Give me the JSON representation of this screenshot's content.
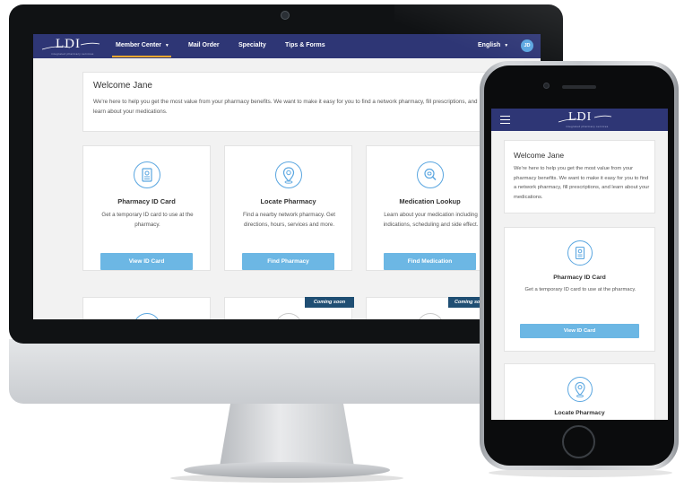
{
  "brand": {
    "logo_text": "LDI",
    "tagline": "integrated pharmacy services"
  },
  "desktop": {
    "nav": {
      "items": [
        {
          "label": "Member Center",
          "dropdown": true,
          "active": true
        },
        {
          "label": "Mail Order"
        },
        {
          "label": "Specialty"
        },
        {
          "label": "Tips & Forms"
        }
      ],
      "language": "English",
      "avatar_initials": "JD"
    },
    "welcome": {
      "title": "Welcome Jane",
      "text": "We're here to help you get the most value from your pharmacy benefits. We want to make it easy for you to find a network pharmacy, fill prescriptions, and learn about your medications."
    },
    "cards": [
      {
        "icon": "id-card-icon",
        "title": "Pharmacy ID Card",
        "description": "Get a temporary ID card to use at the pharmacy.",
        "button": "View ID Card"
      },
      {
        "icon": "location-pin-icon",
        "title": "Locate Pharmacy",
        "description": "Find a nearby network pharmacy. Get directions, hours, services and more.",
        "button": "Find Pharmacy"
      },
      {
        "icon": "pill-search-icon",
        "title": "Medication Lookup",
        "description": "Learn about your medication including indications, scheduling and side effect.",
        "button": "Find Medication"
      }
    ],
    "coming_soon": [
      "Coming soon",
      "Coming so"
    ]
  },
  "mobile": {
    "welcome": {
      "title": "Welcome Jane",
      "text": "We're here to help you get the most value from your pharmacy benefits. We want to make it easy for you to find a network pharmacy, fill prescriptions, and learn about your medications."
    },
    "cards": [
      {
        "icon": "id-card-icon",
        "title": "Pharmacy ID Card",
        "description": "Get a temporary ID card to use at the pharmacy.",
        "button": "View ID Card"
      },
      {
        "icon": "location-pin-icon",
        "title": "Locate Pharmacy"
      }
    ]
  },
  "colors": {
    "navbar": "#2e3675",
    "accent": "#5aa6e0",
    "button": "#6cb7e4",
    "active_tab_underline": "#f0a830",
    "ribbon": "#1f4e73"
  }
}
